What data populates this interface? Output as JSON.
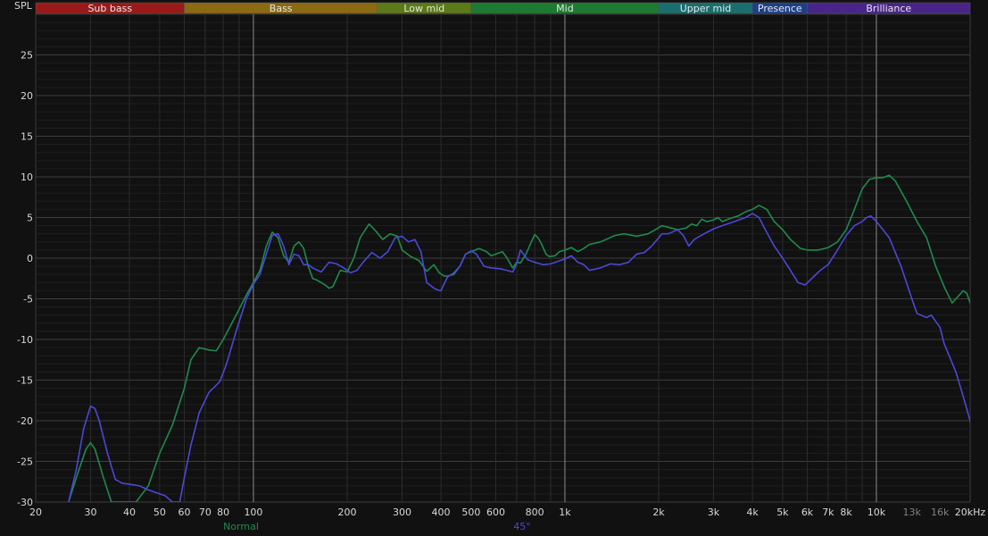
{
  "chart_data": {
    "type": "line",
    "ylabel": "SPL",
    "xlabel": "",
    "x_scale": "log",
    "xlim": [
      20,
      20000
    ],
    "ylim": [
      -30,
      30
    ],
    "grid": true,
    "y_ticks": [
      25,
      20,
      15,
      10,
      5,
      0,
      -5,
      -10,
      -15,
      -20,
      -25,
      -30
    ],
    "x_ticks": [
      {
        "value": 20,
        "label": "20"
      },
      {
        "value": 30,
        "label": "30"
      },
      {
        "value": 40,
        "label": "40"
      },
      {
        "value": 50,
        "label": "50"
      },
      {
        "value": 60,
        "label": "60"
      },
      {
        "value": 70,
        "label": "70"
      },
      {
        "value": 80,
        "label": "80"
      },
      {
        "value": 100,
        "label": "100"
      },
      {
        "value": 200,
        "label": "200"
      },
      {
        "value": 300,
        "label": "300"
      },
      {
        "value": 400,
        "label": "400"
      },
      {
        "value": 500,
        "label": "500"
      },
      {
        "value": 600,
        "label": "600"
      },
      {
        "value": 800,
        "label": "800"
      },
      {
        "value": 1000,
        "label": "1k"
      },
      {
        "value": 2000,
        "label": "2k"
      },
      {
        "value": 3000,
        "label": "3k"
      },
      {
        "value": 4000,
        "label": "4k"
      },
      {
        "value": 5000,
        "label": "5k"
      },
      {
        "value": 6000,
        "label": "6k"
      },
      {
        "value": 7000,
        "label": "7k"
      },
      {
        "value": 8000,
        "label": "8k"
      },
      {
        "value": 10000,
        "label": "10k"
      },
      {
        "value": 13000,
        "label": "13k",
        "muted": true
      },
      {
        "value": 16000,
        "label": "16k",
        "muted": true
      },
      {
        "value": 20000,
        "label": "20kHz"
      }
    ],
    "bands": [
      {
        "label": "Sub bass",
        "from": 20,
        "to": 60,
        "color": "#9a1a1a"
      },
      {
        "label": "Bass",
        "from": 60,
        "to": 250,
        "color": "#8a6a12"
      },
      {
        "label": "Low mid",
        "from": 250,
        "to": 500,
        "color": "#5c7a18"
      },
      {
        "label": "Mid",
        "from": 500,
        "to": 2000,
        "color": "#1d7a32"
      },
      {
        "label": "Upper mid",
        "from": 2000,
        "to": 4000,
        "color": "#1a6e6e"
      },
      {
        "label": "Presence",
        "from": 4000,
        "to": 6000,
        "color": "#1e3f8a"
      },
      {
        "label": "Brilliance",
        "from": 6000,
        "to": 20000,
        "color": "#4a2588"
      }
    ],
    "series": [
      {
        "name": "Normal",
        "color": "#1f8a4c",
        "points": [
          [
            25.5,
            -30
          ],
          [
            27,
            -27
          ],
          [
            29,
            -23.5
          ],
          [
            30,
            -22.7
          ],
          [
            31,
            -23.5
          ],
          [
            33,
            -27
          ],
          [
            35,
            -30
          ],
          [
            42,
            -30
          ],
          [
            46,
            -28
          ],
          [
            50,
            -24
          ],
          [
            55,
            -20.5
          ],
          [
            60,
            -16
          ],
          [
            63,
            -12.5
          ],
          [
            67,
            -11
          ],
          [
            72,
            -11.3
          ],
          [
            76,
            -11.4
          ],
          [
            80,
            -10
          ],
          [
            88,
            -7
          ],
          [
            95,
            -4.5
          ],
          [
            100,
            -3
          ],
          [
            105,
            -1.5
          ],
          [
            110,
            1.5
          ],
          [
            115,
            3.2
          ],
          [
            120,
            2.5
          ],
          [
            125,
            0.3
          ],
          [
            130,
            -0.5
          ],
          [
            135,
            1.5
          ],
          [
            140,
            2
          ],
          [
            145,
            1.2
          ],
          [
            150,
            -1
          ],
          [
            155,
            -2.5
          ],
          [
            160,
            -2.7
          ],
          [
            170,
            -3.3
          ],
          [
            175,
            -3.7
          ],
          [
            180,
            -3.5
          ],
          [
            190,
            -1.5
          ],
          [
            200,
            -1.7
          ],
          [
            210,
            0
          ],
          [
            220,
            2.5
          ],
          [
            235,
            4.2
          ],
          [
            245,
            3.5
          ],
          [
            260,
            2.3
          ],
          [
            275,
            3
          ],
          [
            290,
            2.7
          ],
          [
            300,
            1
          ],
          [
            320,
            0.2
          ],
          [
            340,
            -0.3
          ],
          [
            360,
            -1.6
          ],
          [
            380,
            -0.8
          ],
          [
            395,
            -1.8
          ],
          [
            410,
            -2.2
          ],
          [
            420,
            -2.2
          ],
          [
            440,
            -2
          ],
          [
            460,
            -1
          ],
          [
            480,
            0.5
          ],
          [
            500,
            0.8
          ],
          [
            530,
            1.2
          ],
          [
            560,
            0.8
          ],
          [
            580,
            0.3
          ],
          [
            600,
            0.5
          ],
          [
            630,
            0.8
          ],
          [
            650,
            0.1
          ],
          [
            680,
            -1.2
          ],
          [
            700,
            -0.5
          ],
          [
            720,
            -0.6
          ],
          [
            750,
            0.5
          ],
          [
            780,
            2
          ],
          [
            800,
            2.9
          ],
          [
            820,
            2.5
          ],
          [
            840,
            1.8
          ],
          [
            870,
            0.5
          ],
          [
            890,
            0.2
          ],
          [
            930,
            0.3
          ],
          [
            960,
            0.8
          ],
          [
            1000,
            1
          ],
          [
            1050,
            1.3
          ],
          [
            1100,
            0.8
          ],
          [
            1150,
            1.2
          ],
          [
            1200,
            1.7
          ],
          [
            1300,
            2
          ],
          [
            1450,
            2.8
          ],
          [
            1550,
            3
          ],
          [
            1700,
            2.7
          ],
          [
            1850,
            3
          ],
          [
            1950,
            3.5
          ],
          [
            2050,
            4
          ],
          [
            2150,
            3.8
          ],
          [
            2300,
            3.5
          ],
          [
            2450,
            3.7
          ],
          [
            2550,
            4.2
          ],
          [
            2650,
            4
          ],
          [
            2750,
            4.8
          ],
          [
            2850,
            4.5
          ],
          [
            3000,
            4.7
          ],
          [
            3100,
            5
          ],
          [
            3200,
            4.5
          ],
          [
            3400,
            4.9
          ],
          [
            3600,
            5.2
          ],
          [
            3800,
            5.7
          ],
          [
            4000,
            6
          ],
          [
            4200,
            6.5
          ],
          [
            4450,
            6
          ],
          [
            4700,
            4.5
          ],
          [
            5000,
            3.5
          ],
          [
            5300,
            2.3
          ],
          [
            5700,
            1.2
          ],
          [
            6000,
            1
          ],
          [
            6500,
            1
          ],
          [
            7000,
            1.3
          ],
          [
            7500,
            2
          ],
          [
            8000,
            3.5
          ],
          [
            8500,
            6
          ],
          [
            9000,
            8.5
          ],
          [
            9500,
            9.7
          ],
          [
            10000,
            9.9
          ],
          [
            10500,
            9.9
          ],
          [
            11000,
            10.2
          ],
          [
            11500,
            9.5
          ],
          [
            12500,
            7
          ],
          [
            13500,
            4.5
          ],
          [
            14500,
            2.5
          ],
          [
            15500,
            -1
          ],
          [
            16500,
            -3.5
          ],
          [
            17500,
            -5.5
          ],
          [
            18000,
            -5
          ],
          [
            18500,
            -4.5
          ],
          [
            19000,
            -4
          ],
          [
            19500,
            -4.3
          ],
          [
            20000,
            -5.5
          ],
          [
            21000,
            -7
          ]
        ]
      },
      {
        "name": "45°",
        "color": "#4a48d8",
        "points": [
          [
            25.5,
            -30
          ],
          [
            27,
            -26
          ],
          [
            28.5,
            -21
          ],
          [
            30,
            -18.2
          ],
          [
            31,
            -18.5
          ],
          [
            32,
            -20
          ],
          [
            34,
            -24
          ],
          [
            36,
            -27.2
          ],
          [
            38,
            -27.7
          ],
          [
            40,
            -27.8
          ],
          [
            43,
            -28
          ],
          [
            46,
            -28.5
          ],
          [
            50,
            -29
          ],
          [
            52,
            -29.2
          ],
          [
            55,
            -30
          ],
          [
            58,
            -30
          ],
          [
            60,
            -27
          ],
          [
            63,
            -23
          ],
          [
            67,
            -19
          ],
          [
            72,
            -16.5
          ],
          [
            78,
            -15.2
          ],
          [
            82,
            -13
          ],
          [
            88,
            -9
          ],
          [
            95,
            -5
          ],
          [
            100,
            -3.2
          ],
          [
            105,
            -2
          ],
          [
            110,
            0.5
          ],
          [
            115,
            2.8
          ],
          [
            120,
            3
          ],
          [
            125,
            1.5
          ],
          [
            130,
            -0.8
          ],
          [
            135,
            0.5
          ],
          [
            140,
            0.3
          ],
          [
            145,
            -0.8
          ],
          [
            150,
            -0.8
          ],
          [
            155,
            -1.2
          ],
          [
            165,
            -1.7
          ],
          [
            175,
            -0.5
          ],
          [
            185,
            -0.7
          ],
          [
            195,
            -1.2
          ],
          [
            205,
            -1.8
          ],
          [
            215,
            -1.5
          ],
          [
            225,
            -0.5
          ],
          [
            240,
            0.7
          ],
          [
            255,
            0
          ],
          [
            270,
            0.8
          ],
          [
            285,
            2.5
          ],
          [
            300,
            2.7
          ],
          [
            315,
            2
          ],
          [
            330,
            2.3
          ],
          [
            345,
            0.8
          ],
          [
            360,
            -3
          ],
          [
            380,
            -3.7
          ],
          [
            390,
            -3.9
          ],
          [
            400,
            -4
          ],
          [
            420,
            -2.3
          ],
          [
            440,
            -1.8
          ],
          [
            460,
            -1
          ],
          [
            480,
            0.5
          ],
          [
            500,
            0.9
          ],
          [
            520,
            0.5
          ],
          [
            550,
            -1
          ],
          [
            580,
            -1.2
          ],
          [
            620,
            -1.3
          ],
          [
            650,
            -1.5
          ],
          [
            680,
            -1.7
          ],
          [
            700,
            -0.7
          ],
          [
            720,
            1
          ],
          [
            740,
            0.4
          ],
          [
            760,
            -0.2
          ],
          [
            800,
            -0.5
          ],
          [
            850,
            -0.8
          ],
          [
            900,
            -0.7
          ],
          [
            950,
            -0.4
          ],
          [
            1000,
            -0.1
          ],
          [
            1050,
            0.3
          ],
          [
            1100,
            -0.5
          ],
          [
            1150,
            -0.8
          ],
          [
            1200,
            -1.5
          ],
          [
            1300,
            -1.2
          ],
          [
            1400,
            -0.7
          ],
          [
            1500,
            -0.8
          ],
          [
            1600,
            -0.5
          ],
          [
            1700,
            0.5
          ],
          [
            1800,
            0.7
          ],
          [
            1900,
            1.5
          ],
          [
            2050,
            3
          ],
          [
            2150,
            3
          ],
          [
            2300,
            3.5
          ],
          [
            2400,
            2.8
          ],
          [
            2500,
            1.5
          ],
          [
            2600,
            2.3
          ],
          [
            2800,
            3
          ],
          [
            3000,
            3.6
          ],
          [
            3200,
            4
          ],
          [
            3500,
            4.5
          ],
          [
            3800,
            5
          ],
          [
            4000,
            5.5
          ],
          [
            4200,
            5
          ],
          [
            4400,
            3.5
          ],
          [
            4700,
            1.5
          ],
          [
            5000,
            0
          ],
          [
            5300,
            -1.5
          ],
          [
            5600,
            -3
          ],
          [
            5900,
            -3.3
          ],
          [
            6200,
            -2.5
          ],
          [
            6600,
            -1.5
          ],
          [
            7000,
            -0.8
          ],
          [
            7500,
            1
          ],
          [
            8000,
            2.8
          ],
          [
            8500,
            4
          ],
          [
            9000,
            4.5
          ],
          [
            9300,
            5
          ],
          [
            9600,
            5.2
          ],
          [
            10000,
            4.5
          ],
          [
            10500,
            3.5
          ],
          [
            11000,
            2.5
          ],
          [
            12000,
            -1
          ],
          [
            13000,
            -5
          ],
          [
            13500,
            -6.8
          ],
          [
            14500,
            -7.3
          ],
          [
            15000,
            -7
          ],
          [
            16000,
            -8.5
          ],
          [
            16500,
            -10.5
          ],
          [
            18000,
            -14
          ],
          [
            19000,
            -17
          ],
          [
            20000,
            -20
          ],
          [
            21000,
            -24
          ],
          [
            21500,
            -26.5
          ]
        ]
      }
    ]
  }
}
